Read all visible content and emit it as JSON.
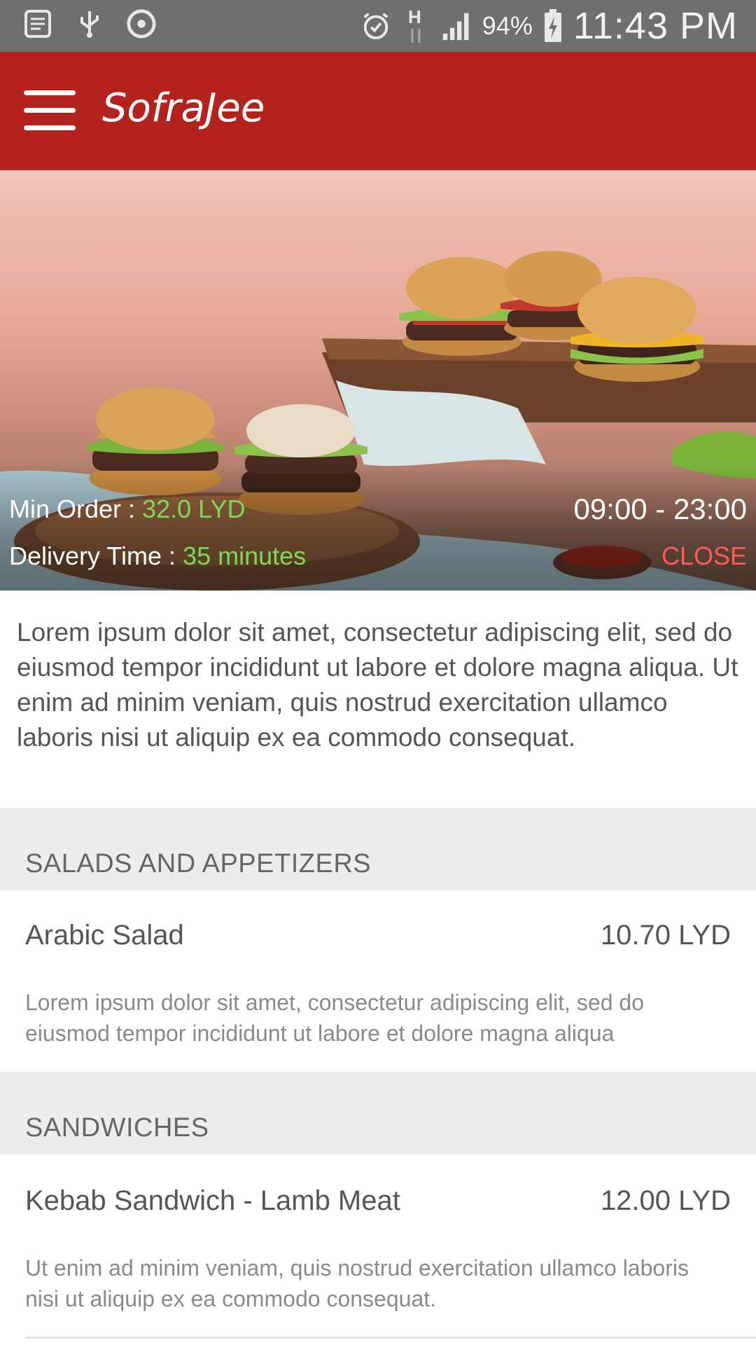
{
  "status_bar": {
    "battery": "94%",
    "time": "11:43 PM",
    "network": "H",
    "icons": [
      "notes-icon",
      "usb-icon",
      "sync-icon",
      "alarm-icon",
      "network-arrows-icon",
      "signal-icon",
      "battery-charging-icon"
    ]
  },
  "app_bar": {
    "title": "SofraJee",
    "menu_icon": "hamburger-menu-icon",
    "background_color": "#b3221c"
  },
  "restaurant": {
    "min_order_label": "Min Order : ",
    "min_order_value": "32.0 LYD",
    "delivery_label": "Delivery Time : ",
    "delivery_value": "35 minutes",
    "hours": "09:00 - 23:00",
    "status": "CLOSE",
    "status_color": "#ff5a5a",
    "accent_green": "#7ed957",
    "description": "Lorem ipsum dolor sit amet, consectetur adipiscing elit, sed do eiusmod tempor incididunt ut labore et dolore magna aliqua. Ut enim ad minim veniam, quis nostrud exercitation ullamco laboris nisi ut aliquip ex ea commodo consequat."
  },
  "sections": [
    {
      "title": "SALADS AND APPETIZERS",
      "items": [
        {
          "name": "Arabic Salad",
          "price": "10.70 LYD",
          "description": "Lorem ipsum dolor sit amet, consectetur adipiscing elit, sed do eiusmod tempor incididunt ut labore et dolore magna aliqua"
        }
      ]
    },
    {
      "title": "SANDWICHES",
      "items": [
        {
          "name": "Kebab Sandwich - Lamb Meat",
          "price": "12.00 LYD",
          "description": "Ut enim ad minim veniam, quis nostrud exercitation ullamco laboris nisi ut aliquip ex ea commodo consequat."
        }
      ]
    }
  ]
}
